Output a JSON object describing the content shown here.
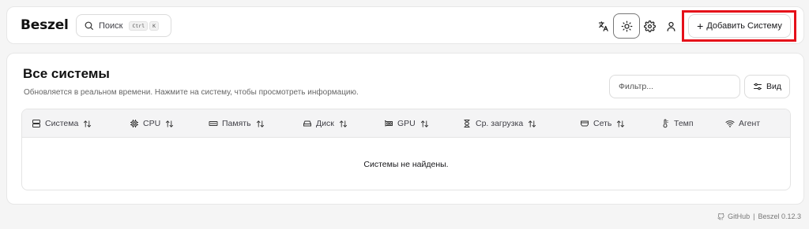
{
  "app": {
    "logo": "Beszel"
  },
  "search": {
    "label": "Поиск",
    "kbd": [
      "Ctrl",
      "K"
    ]
  },
  "header": {
    "add_button": "Добавить Систему"
  },
  "main": {
    "title": "Все системы",
    "subtitle": "Обновляется в реальном времени. Нажмите на систему, чтобы просмотреть информацию.",
    "filter_placeholder": "Фильтр...",
    "view_button": "Вид"
  },
  "table": {
    "columns": [
      "Система",
      "CPU",
      "Память",
      "Диск",
      "GPU",
      "Ср. загрузка",
      "Сеть",
      "Темп",
      "Агент"
    ],
    "empty": "Системы не найдены."
  },
  "footer": {
    "github": "GitHub",
    "separator": "|",
    "version": "Beszel 0.12.3"
  },
  "colors": {
    "highlight": "#e5101a",
    "background": "#f5f5f5",
    "card": "#ffffff"
  }
}
